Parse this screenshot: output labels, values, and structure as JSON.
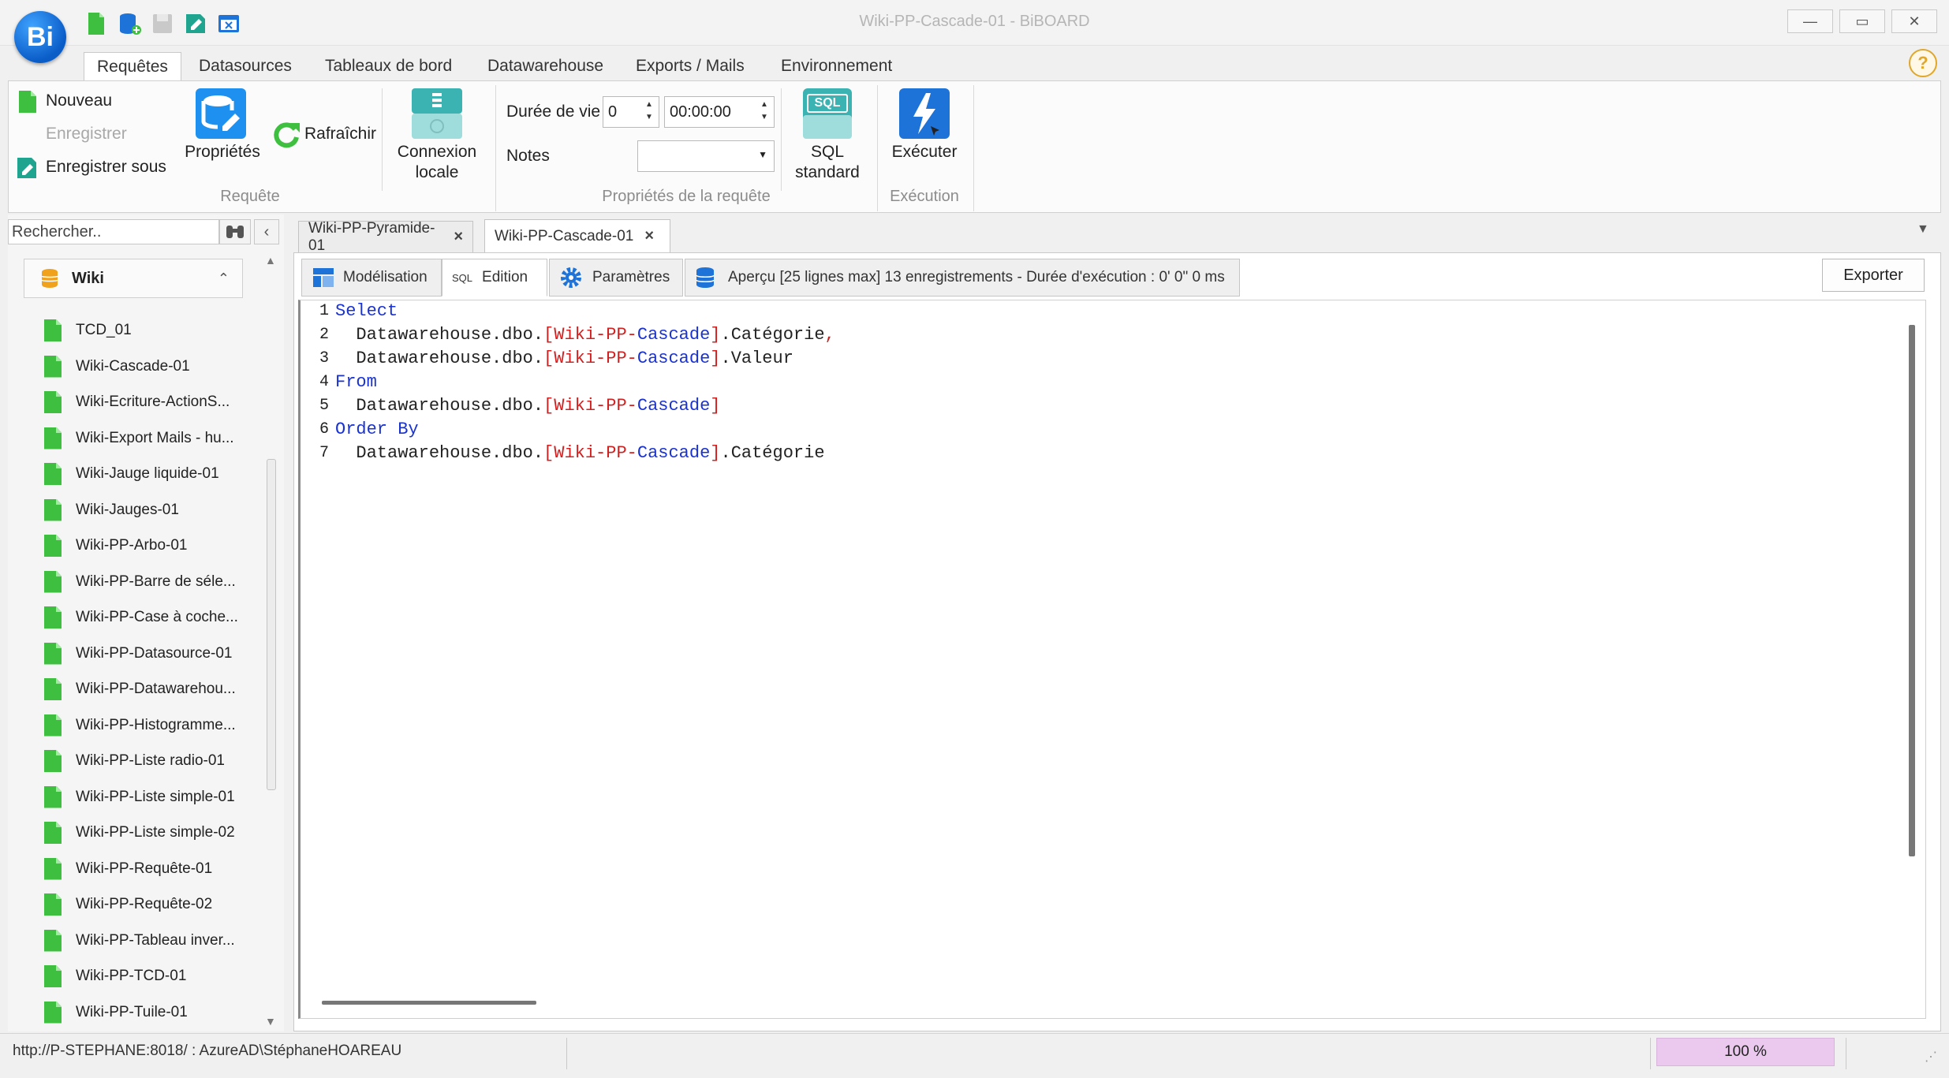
{
  "window": {
    "title": "Wiki-PP-Cascade-01 - BiBOARD",
    "logo_text": "Bi",
    "minimize": "—",
    "maximize": "▭",
    "close": "✕"
  },
  "ribbon_tabs": [
    "Requêtes",
    "Datasources",
    "Tableaux de bord",
    "Datawarehouse",
    "Exports / Mails",
    "Environnement"
  ],
  "help": "?",
  "ribbon": {
    "requete": {
      "nouveau": "Nouveau",
      "enregistrer": "Enregistrer",
      "enregistrer_sous": "Enregistrer sous",
      "proprietes": "Propriétés",
      "rafraichir": "Rafraîchir",
      "connexion_line1": "Connexion",
      "connexion_line2": "locale",
      "group_label": "Requête"
    },
    "proprietes_requete": {
      "duree_label": "Durée de vie",
      "duree_value": "0",
      "duree_time": "00:00:00",
      "notes_label": "Notes",
      "notes_value": "",
      "sql_icon_text": "SQL",
      "sql_line1": "SQL",
      "sql_line2": "standard",
      "group_label": "Propriétés de la requête"
    },
    "execution": {
      "executer": "Exécuter",
      "group_label": "Exécution"
    }
  },
  "left_panel": {
    "search_value": "Rechercher..",
    "group_name": "Wiki",
    "items": [
      "TCD_01",
      "Wiki-Cascade-01",
      "Wiki-Ecriture-ActionS...",
      "Wiki-Export Mails - hu...",
      "Wiki-Jauge liquide-01",
      "Wiki-Jauges-01",
      "Wiki-PP-Arbo-01",
      "Wiki-PP-Barre de séle...",
      "Wiki-PP-Case à coche...",
      "Wiki-PP-Datasource-01",
      "Wiki-PP-Datawarehou...",
      "Wiki-PP-Histogramme...",
      "Wiki-PP-Liste radio-01",
      "Wiki-PP-Liste simple-01",
      "Wiki-PP-Liste simple-02",
      "Wiki-PP-Requête-01",
      "Wiki-PP-Requête-02",
      "Wiki-PP-Tableau inver...",
      "Wiki-PP-TCD-01",
      "Wiki-PP-Tuile-01"
    ]
  },
  "doc_tabs": [
    "Wiki-PP-Pyramide-01",
    "Wiki-PP-Cascade-01"
  ],
  "sub_tabs": {
    "modelisation": "Modélisation",
    "edition_prefix": "SQL",
    "edition": "Edition",
    "parametres": "Paramètres",
    "apercu": "Aperçu [25 lignes max]  13 enregistrements - Durée d'exécution : 0' 0\" 0 ms"
  },
  "export": "Exporter",
  "editor": {
    "lines": [
      {
        "n": "1",
        "kw": "Select"
      },
      {
        "n": "2",
        "db": "Datawarehouse.dbo.",
        "tp": "[Wiki-",
        "tm": "PP",
        "td": "-",
        "tc": "Cascade",
        "tz": "]",
        "col": ".Catégorie",
        "trail": ","
      },
      {
        "n": "3",
        "db": "Datawarehouse.dbo.",
        "tp": "[Wiki-",
        "tm": "PP",
        "td": "-",
        "tc": "Cascade",
        "tz": "]",
        "col": ".Valeur",
        "trail": ""
      },
      {
        "n": "4",
        "kw": "From"
      },
      {
        "n": "5",
        "db": "Datawarehouse.dbo.",
        "tp": "[Wiki-",
        "tm": "PP",
        "td": "-",
        "tc": "Cascade",
        "tz": "]",
        "col": "",
        "trail": ""
      },
      {
        "n": "6",
        "kw": "Order By"
      },
      {
        "n": "7",
        "db": "Datawarehouse.dbo.",
        "tp": "[Wiki-",
        "tm": "PP",
        "td": "-",
        "tc": "Cascade",
        "tz": "]",
        "col": ".Catégorie",
        "trail": ""
      }
    ]
  },
  "status": {
    "url": "http://P-STEPHANE:8018/ : AzureAD\\StéphaneHOAREAU",
    "zoom": "100 %"
  },
  "colors": {
    "keyword": "#1a33d0",
    "bracket": "#d02020",
    "accent": "#1e73d8",
    "doc_icon": "#3fbf3f"
  }
}
